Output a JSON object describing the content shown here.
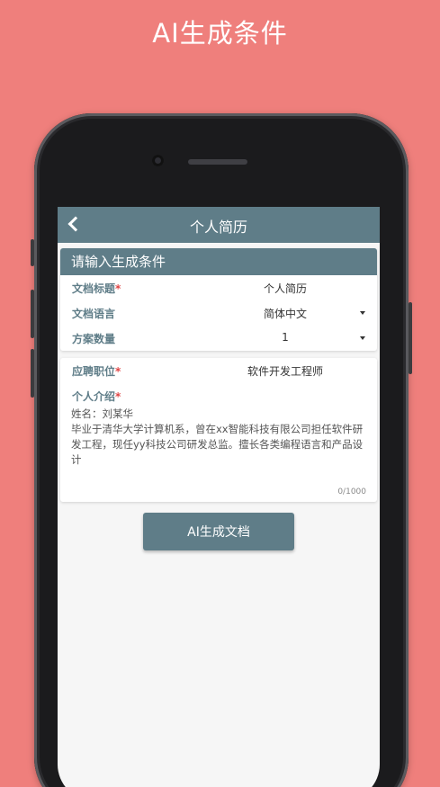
{
  "banner": {
    "title": "AI生成条件"
  },
  "nav": {
    "title": "个人简历"
  },
  "form": {
    "header": "请输入生成条件",
    "fields": [
      {
        "label": "文档标题",
        "required": "*",
        "value": "个人简历"
      },
      {
        "label": "文档语言",
        "required": "",
        "value": "简体中文"
      },
      {
        "label": "方案数量",
        "required": "",
        "value": "1"
      }
    ],
    "position": {
      "label": "应聘职位",
      "required": "*",
      "value": "软件开发工程师"
    },
    "intro": {
      "label": "个人介绍",
      "required": "*",
      "text": "姓名：刘某华\n毕业于清华大学计算机系，曾在xx智能科技有限公司担任软件研发工程，现任yy科技公司研发总监。擅长各类编程语言和产品设计",
      "counter": "0/1000"
    }
  },
  "actions": {
    "generate_label": "AI生成文档"
  }
}
